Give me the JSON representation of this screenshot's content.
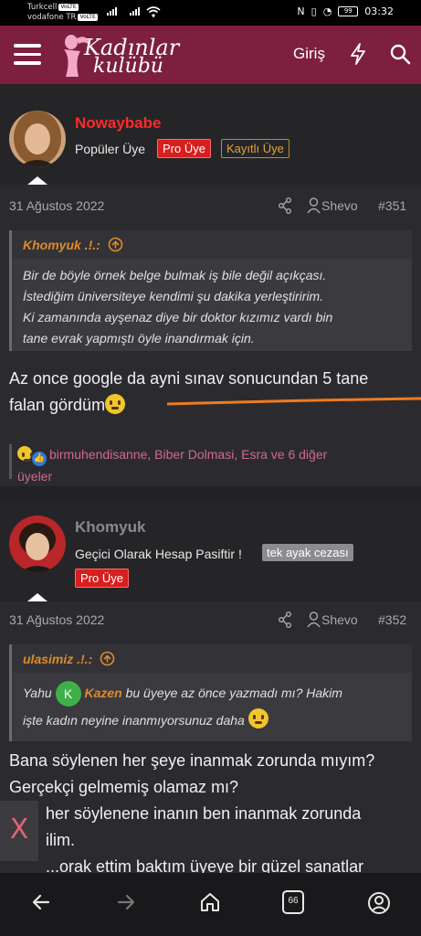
{
  "status_bar": {
    "carrier1": "Turkcell",
    "carrier2": "vodafone TR",
    "volte": "VoLTE",
    "network_type": "4G",
    "battery": "99",
    "time": "03:32"
  },
  "header": {
    "logo_line1": "Kadınlar",
    "logo_line2": "kulübü",
    "login": "Giriş",
    "bg_color": "#7d1f3e"
  },
  "posts": [
    {
      "username": "Nowaybabe",
      "username_color": "#ff2a2a",
      "user_title": "Popüler Üye",
      "badges": [
        "Pro Üye",
        "Kayıtlı Üye"
      ],
      "date": "31 Ağustos 2022",
      "meta_name": "Shevo",
      "post_number": "#351",
      "quote": {
        "author": "Khomyuk .!.:",
        "lines": [
          "Bir de böyle örnek belge bulmak iş bile değil açıkçası.",
          "İstediğim üniversiteye kendimi şu dakika yerleştiririm.",
          "Ki zamanında ayşenaz diye bir doktor kızımız vardı bin",
          "tane evrak yapmıştı öyle inandırmak için."
        ]
      },
      "message_lines": [
        "Az once google da ayni sınav sonucundan 5 tane",
        "falan gördüm"
      ],
      "reactions": {
        "line1": "birmuhendisanne, Biber Dolmasi, Esra ve 6 diğer",
        "line2": "üyeler"
      }
    },
    {
      "username": "Khomyuk",
      "username_color": "#8a8a8e",
      "user_title": "Geçici Olarak Hesap Pasiftir !",
      "badges": [
        "tek ayak cezası",
        "Pro Üye"
      ],
      "date": "31 Ağustos 2022",
      "meta_name": "Shevo",
      "post_number": "#352",
      "quote": {
        "author": "ulasimiz .!.:",
        "mention_initial": "K",
        "mention_name": "Kazen",
        "line1_pre": "Yahu",
        "line1_post": "bu üyeye az önce yazmadı mı? Hakim",
        "line2": "işte kadın neyine inanmıyorsunuz daha"
      },
      "message_lines": [
        "Bana söylenen her şeye inanmak zorunda mıyım?",
        "Gerçekçi gelmemiş olamaz mı?",
        "her söylenene inanın ben inanmak zorunda",
        "ilim.",
        "...orak ettim baktım üyeye bir güzel sanatlar"
      ]
    }
  ],
  "close_button": "X",
  "nav": [
    "back-icon",
    "forward-icon",
    "home-icon",
    "tabs-icon",
    "profile-icon"
  ],
  "nav_tabs_count": "66"
}
